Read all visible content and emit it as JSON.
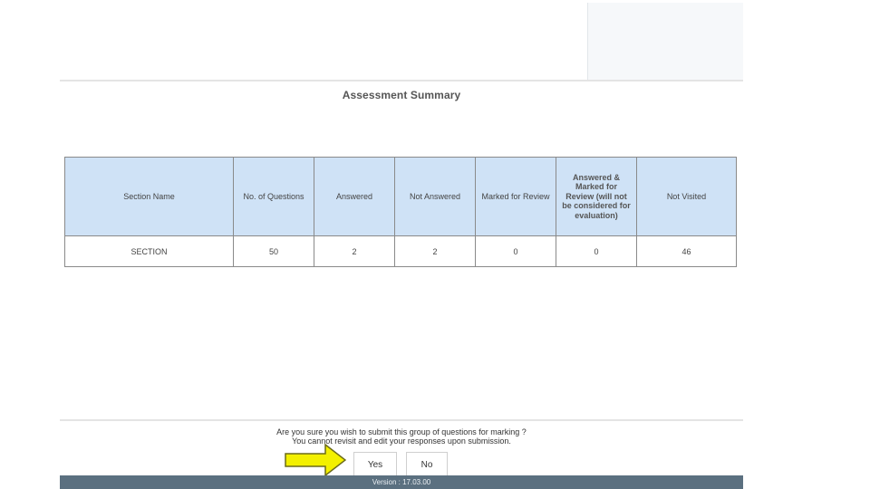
{
  "page": {
    "title": "Assessment Summary"
  },
  "table": {
    "headers": [
      "Section Name",
      "No. of Questions",
      "Answered",
      "Not Answered",
      "Marked for Review",
      "Answered & Marked for Review (will not be considered for evaluation)",
      "Not Visited"
    ],
    "rows": [
      [
        "SECTION",
        "50",
        "2",
        "2",
        "0",
        "0",
        "46"
      ]
    ]
  },
  "confirm": {
    "line1": "Are you sure you wish to submit this group of questions for marking ?",
    "line2": "You cannot revisit and edit your responses upon submission."
  },
  "buttons": {
    "yes": "Yes",
    "no": "No"
  },
  "footer": {
    "version": "Version : 17.03.00"
  },
  "colors": {
    "header_bg": "#cfe2f6",
    "footer_bg": "#5b7080",
    "arrow_fill": "#f3f000"
  },
  "icons": {
    "pointer": "arrow-right-icon"
  }
}
